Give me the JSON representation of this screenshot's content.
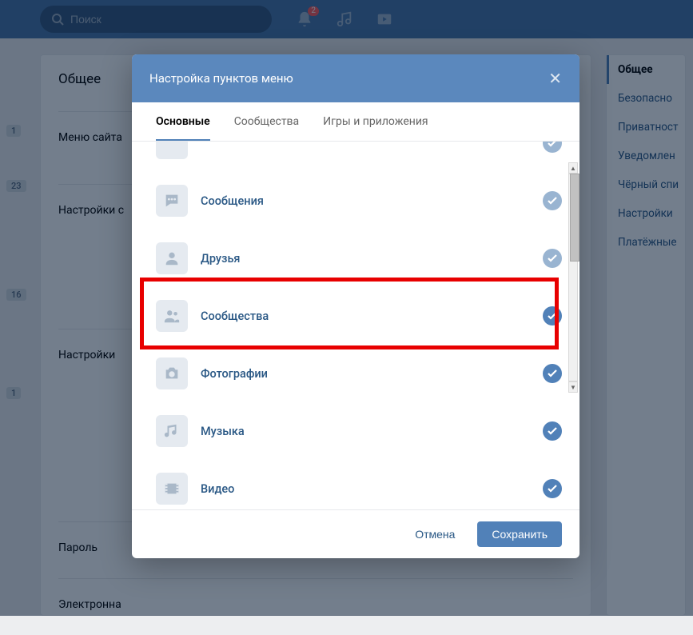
{
  "header": {
    "search_placeholder": "Поиск",
    "notif_count": "2"
  },
  "badges": {
    "b1": "1",
    "b2": "23",
    "b3": "16",
    "b4": "1"
  },
  "main": {
    "title": "Общее",
    "sections": {
      "menu": "Меню сайта",
      "settings1": "Настройки с",
      "settings2": "Настройки",
      "password": "Пароль",
      "email": "Электронна"
    }
  },
  "right_menu": {
    "items": [
      "Общее",
      "Безопасно",
      "Приватност",
      "Уведомлен",
      "Чёрный спи",
      "Настройки",
      "Платёжные"
    ]
  },
  "modal": {
    "title": "Настройка пунктов меню",
    "tabs": {
      "main": "Основные",
      "groups": "Сообщества",
      "apps": "Игры и приложения"
    },
    "items": {
      "messages": "Сообщения",
      "friends": "Друзья",
      "communities": "Сообщества",
      "photos": "Фотографии",
      "music": "Музыка",
      "video": "Видео"
    },
    "footer": {
      "cancel": "Отмена",
      "save": "Сохранить"
    }
  }
}
